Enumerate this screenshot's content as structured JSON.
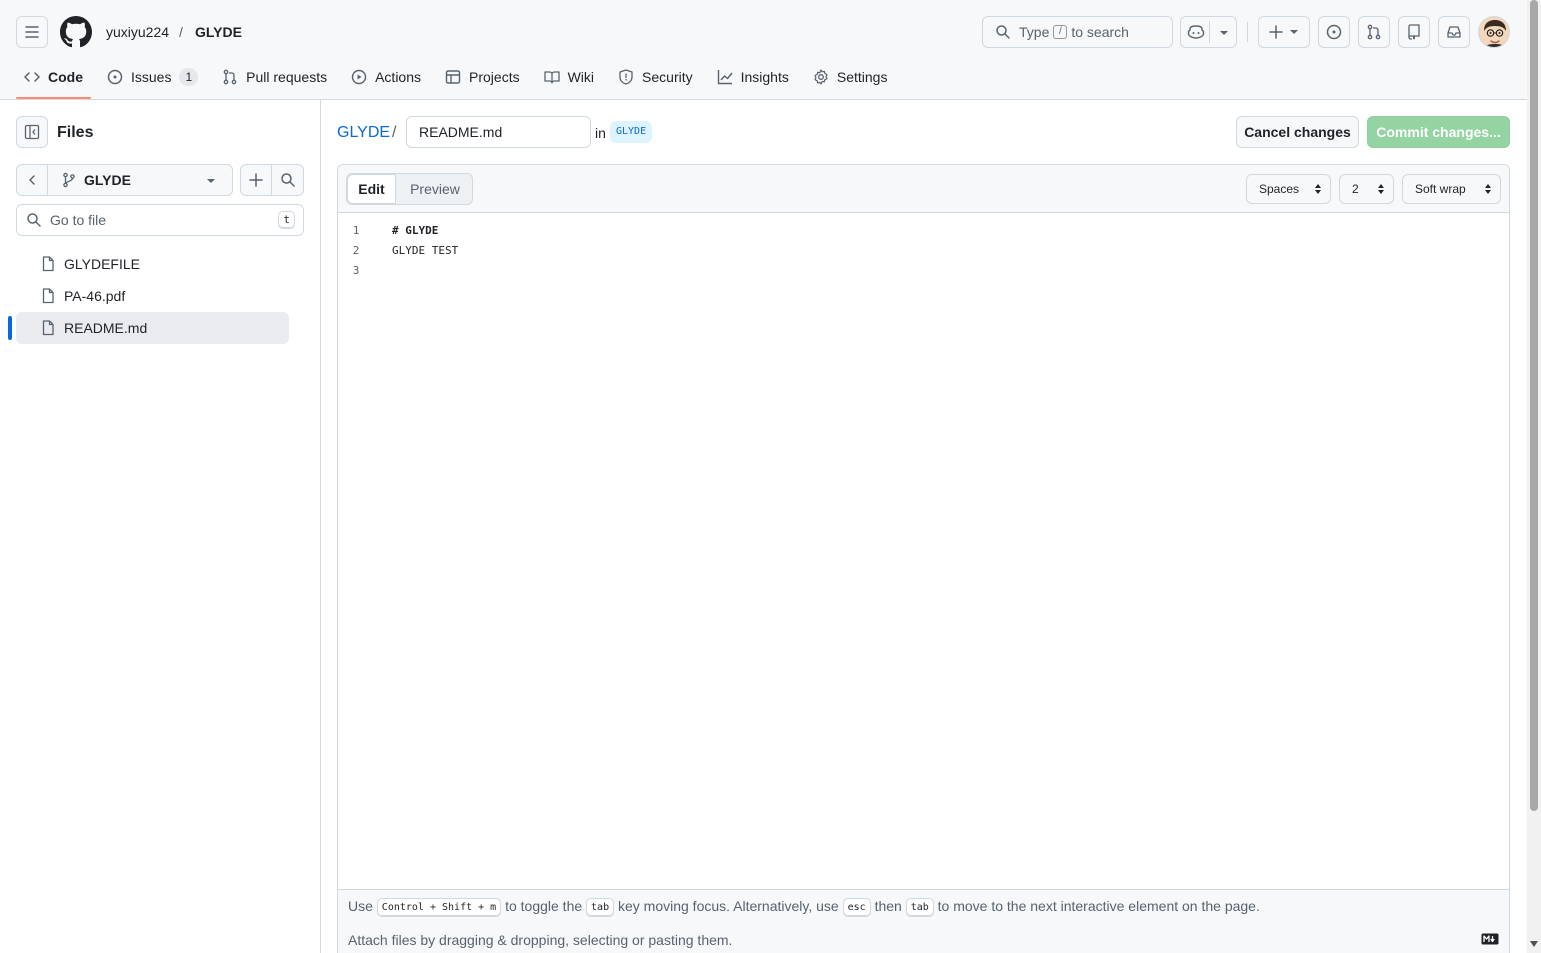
{
  "header": {
    "owner": "yuxiyu224",
    "separator": "/",
    "repo": "GLYDE",
    "search": {
      "prefix": "Type",
      "key": "/",
      "suffix": "to search"
    }
  },
  "nav": {
    "tabs": [
      {
        "label": "Code",
        "icon": "code-icon",
        "selected": true
      },
      {
        "label": "Issues",
        "icon": "issue-opened-icon",
        "count": "1"
      },
      {
        "label": "Pull requests",
        "icon": "git-pull-request-icon"
      },
      {
        "label": "Actions",
        "icon": "play-icon"
      },
      {
        "label": "Projects",
        "icon": "table-icon"
      },
      {
        "label": "Wiki",
        "icon": "book-icon"
      },
      {
        "label": "Security",
        "icon": "shield-icon"
      },
      {
        "label": "Insights",
        "icon": "graph-icon"
      },
      {
        "label": "Settings",
        "icon": "gear-icon"
      }
    ]
  },
  "sidebar": {
    "title": "Files",
    "branch": "GLYDE",
    "go_to_file_placeholder": "Go to file",
    "go_to_file_shortcut": "t",
    "files": [
      {
        "name": "GLYDEFILE",
        "active": false
      },
      {
        "name": "PA-46.pdf",
        "active": false
      },
      {
        "name": "README.md",
        "active": true
      }
    ]
  },
  "editor": {
    "breadcrumb_repo": "GLYDE",
    "breadcrumb_sep": "/",
    "filename": "README.md",
    "in_label": "in",
    "branch_badge": "GLYDE",
    "cancel_label": "Cancel changes",
    "commit_label": "Commit changes...",
    "tabs": {
      "edit": "Edit",
      "preview": "Preview"
    },
    "indent_mode": "Spaces",
    "indent_size": "2",
    "wrap_mode": "Soft wrap",
    "lines": [
      {
        "num": "1",
        "text": "# GLYDE"
      },
      {
        "num": "2",
        "text": "GLYDE TEST"
      },
      {
        "num": "3",
        "text": ""
      }
    ],
    "footer": {
      "use": "Use",
      "shortcut": "Control + Shift + m",
      "toggle": "to toggle the",
      "tab_key": "tab",
      "moving": "key moving focus. Alternatively, use",
      "esc_key": "esc",
      "then": "then",
      "tab_key2": "tab",
      "rest": "to move to the next interactive element on the page.",
      "attach": "Attach files by dragging & dropping, selecting or pasting them."
    }
  },
  "colors": {
    "accent_link": "#0969da",
    "commit_disabled_bg": "#94d3a2",
    "nav_underline": "#fd8c73"
  }
}
